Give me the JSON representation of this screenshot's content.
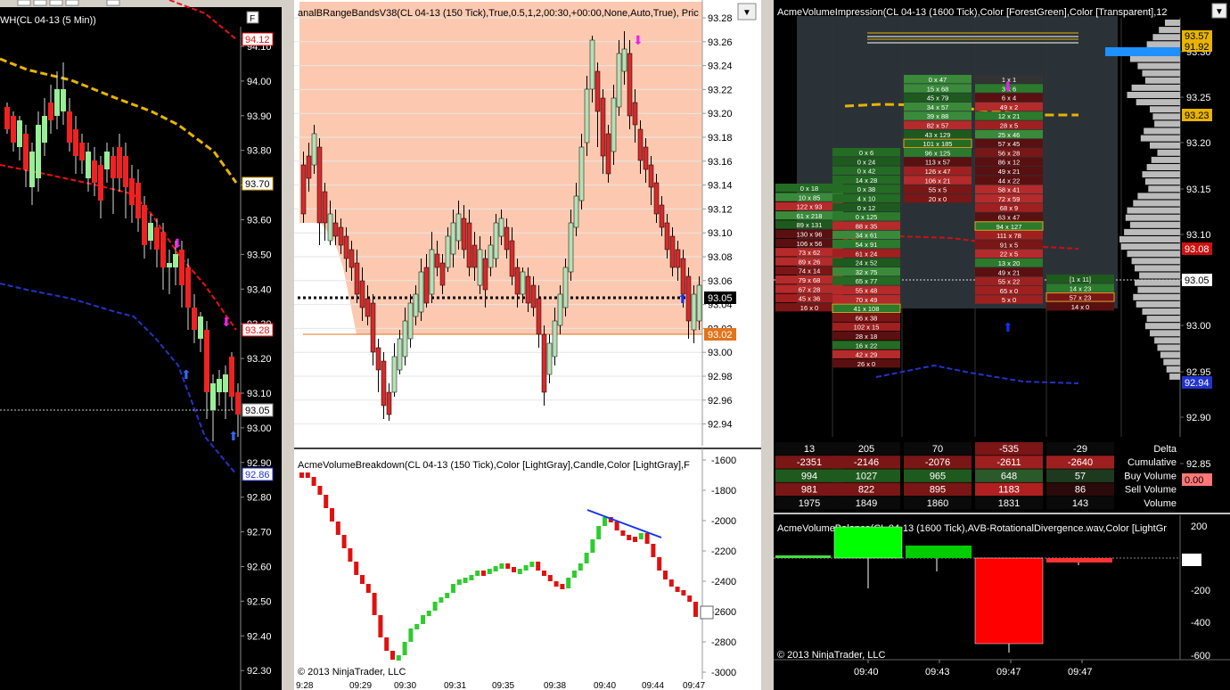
{
  "left": {
    "title": "WH(CL 04-13 (5 Min))",
    "f_label": "F",
    "price_labels": [
      "94.10",
      "94.00",
      "93.90",
      "93.80",
      "93.70",
      "93.60",
      "93.50",
      "93.40",
      "93.30",
      "93.20",
      "93.10",
      "93.00",
      "92.90",
      "92.80",
      "92.70",
      "92.60",
      "92.50",
      "92.40",
      "92.30"
    ],
    "tags": {
      "red_top": "94.12",
      "yellow": "93.70",
      "red_low": "93.28",
      "current": "93.05",
      "blue": "92.86"
    }
  },
  "middle": {
    "title": "analBRangeBandsV38(CL 04-13 (150 Tick),True,0.5,1,2,00:30,+00:00,None,Auto,True), Pric",
    "dropdown_icon": "chevron-down-icon",
    "price_labels": [
      "93.28",
      "93.26",
      "93.24",
      "93.22",
      "93.20",
      "93.18",
      "93.16",
      "93.14",
      "93.12",
      "93.10",
      "93.08",
      "93.06",
      "93.04",
      "93.02",
      "93.00",
      "92.98",
      "92.96",
      "92.94"
    ],
    "tags": {
      "current": "93.05",
      "orange": "93.02"
    },
    "lower_title": "AcmeVolumeBreakdown(CL 04-13 (150 Tick),Color [LightGray],Candle,Color [LightGray],F",
    "lower_labels": [
      "-1600",
      "-1800",
      "-2000",
      "-2200",
      "-2400",
      "-2600",
      "-2800",
      "-3000"
    ],
    "copyright": "© 2013 NinjaTrader, LLC",
    "time_labels": [
      "9:28",
      "09:29",
      "09:30",
      "09:31",
      "09:35",
      "09:38",
      "09:40",
      "09:44",
      "09:47"
    ]
  },
  "right": {
    "title": "AcmeVolumeImpression(CL 04-13 (1600 Tick),Color [ForestGreen],Color [Transparent],12",
    "price_labels": [
      "93.30",
      "93.25",
      "93.20",
      "93.15",
      "93.10",
      "93.05",
      "93.00",
      "92.95",
      "92.90",
      "92.85"
    ],
    "tags": {
      "top1": "93.57",
      "top2": "91.92",
      "yellow": "93.23",
      "red": "93.08",
      "current": "93.05",
      "blue": "92.94",
      "zero": "0.00"
    },
    "columns": [
      [
        "0 x 18",
        "10 x 85",
        "122 x 93",
        "61 x 218",
        "89 x 131",
        "130 x 96",
        "106 x 56",
        "73 x 62",
        "89 x 26",
        "74 x 14",
        "79 x 68",
        "67 x 28",
        "45 x 36",
        "16 x 0"
      ],
      [
        "0 x 6",
        "0 x 24",
        "0 x 42",
        "14 x 28",
        "0 x 38",
        "4 x 10",
        "0 x 12",
        "0 x 125",
        "88 x 35",
        "34 x 61",
        "54 x 91",
        "61 x 24",
        "24 x 52",
        "32 x 75",
        "65 x 77",
        "55 x 48",
        "70 x 49",
        "41 x 108",
        "66 x 38",
        "102 x 15",
        "28 x 18",
        "16 x 22",
        "42 x 29",
        "26 x 0"
      ],
      [
        "0 x 47",
        "15 x 68",
        "45 x 79",
        "34 x 57",
        "39 x 88",
        "82 x 57",
        "43 x 129",
        "101 x 185",
        "96 x 125",
        "113 x 57",
        "126 x 47",
        "106 x 21",
        "55 x 5",
        "20 x 0"
      ],
      [
        "1 x 1",
        "3 x 6",
        "6 x 4",
        "49 x 2",
        "12 x 21",
        "28 x 5",
        "25 x 46",
        "57 x 45",
        "56 x 28",
        "86 x 12",
        "49 x 21",
        "44 x 22",
        "58 x 41",
        "72 x 59",
        "68 x 9",
        "63 x 47",
        "94 x 127",
        "111 x 78",
        "91 x 5",
        "22 x 5",
        "13 x 20",
        "49 x 21",
        "55 x 22",
        "65 x 0",
        "5 x 0"
      ],
      [
        "[1 x 11]",
        "14 x 23",
        "57 x 23",
        "14 x 0"
      ]
    ],
    "stats_labels": [
      "Delta",
      "Cumulative",
      "Buy Volume",
      "Sell Volume",
      "Volume"
    ],
    "stats": [
      [
        "13",
        "205",
        "70",
        "-535",
        "-29"
      ],
      [
        "-2351",
        "-2146",
        "-2076",
        "-2611",
        "-2640"
      ],
      [
        "994",
        "1027",
        "965",
        "648",
        "57"
      ],
      [
        "981",
        "822",
        "895",
        "1183",
        "86"
      ],
      [
        "1975",
        "1849",
        "1860",
        "1831",
        "143"
      ]
    ],
    "lower_title": "AcmeVolumeBalance(CL 04-13 (1600 Tick),AVB-RotationalDivergence.wav,Color [LightGr",
    "lower_labels": [
      "200",
      "0",
      "-200",
      "-400",
      "-600"
    ],
    "copyright": "© 2013 NinjaTrader, LLC",
    "time_labels": [
      "09:40",
      "09:43",
      "09:47",
      "09:47"
    ]
  }
}
